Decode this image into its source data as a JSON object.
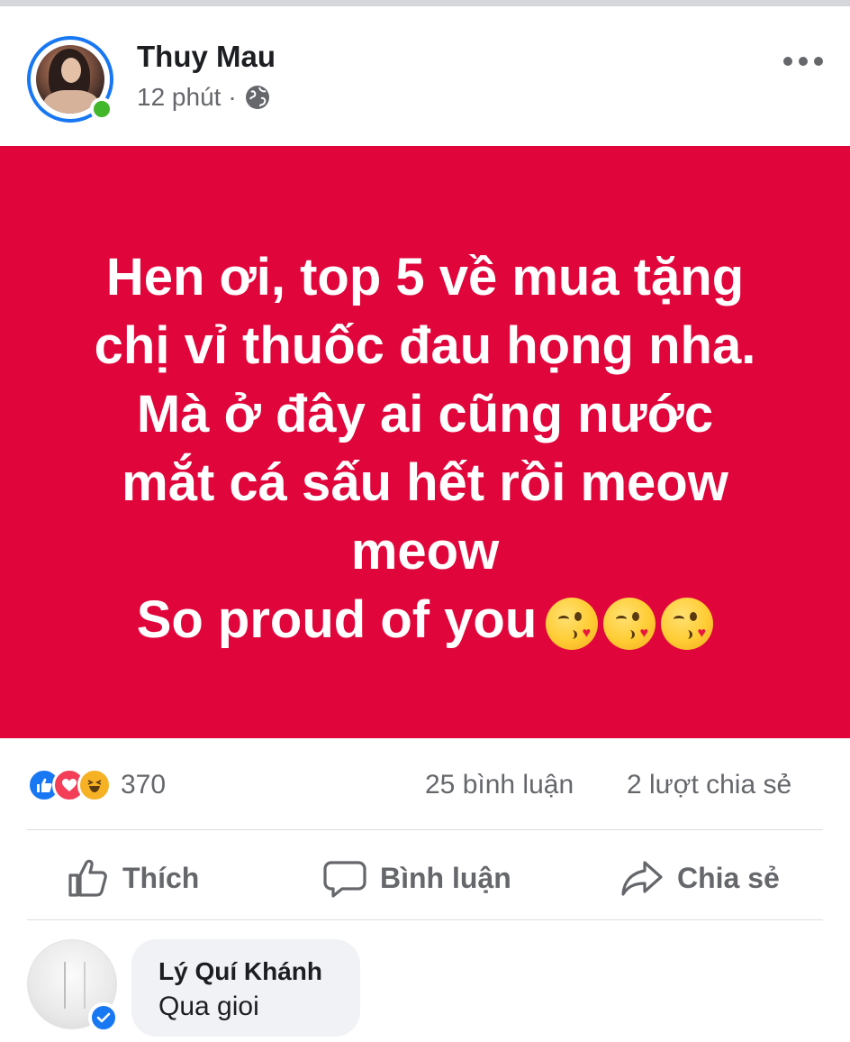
{
  "post": {
    "author": "Thuy Mau",
    "time": "12 phút",
    "separator": "·",
    "privacy_icon": "globe-icon",
    "background_color": "#e0053b",
    "text_lines": [
      "Hen ơi, top 5 về mua tặng",
      "chị vỉ thuốc đau họng nha.",
      "Mà ở đây ai cũng nước",
      "mắt cá sấu hết rồi meow",
      "meow",
      "So proud of you"
    ],
    "trailing_emojis": [
      "face-blowing-kiss-icon",
      "face-blowing-kiss-icon",
      "face-blowing-kiss-icon"
    ]
  },
  "stats": {
    "reaction_icons": [
      "like-icon",
      "love-icon",
      "haha-icon"
    ],
    "reactions": "370",
    "comments": "25 bình luận",
    "shares": "2 lượt chia sẻ"
  },
  "actions": {
    "like": "Thích",
    "comment": "Bình luận",
    "share": "Chia sẻ"
  },
  "comment": {
    "author": "Lý Quí Khánh",
    "text": "Qua gioi",
    "verified_icon": "verified-badge-icon"
  },
  "colors": {
    "accent": "#1877f2",
    "online": "#42b72a",
    "muted_text": "#65676b"
  }
}
